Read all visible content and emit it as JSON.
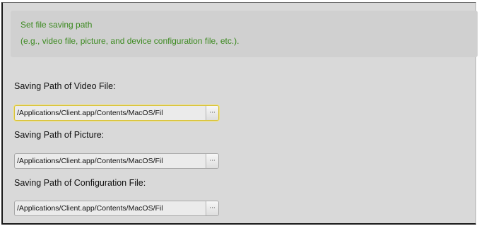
{
  "info": {
    "line1": "Set file saving path",
    "line2": "(e.g., video file, picture, and device configuration file, etc.)."
  },
  "fields": [
    {
      "label": "Saving Path of Video File:",
      "value": "/Applications/Client.app/Contents/MacOS/Fil",
      "button": "···",
      "focused": true
    },
    {
      "label": "Saving Path of Picture:",
      "value": "/Applications/Client.app/Contents/MacOS/Fil",
      "button": "···",
      "focused": false
    },
    {
      "label": "Saving Path of Configuration File:",
      "value": "/Applications/Client.app/Contents/MacOS/Fil",
      "button": "···",
      "focused": false
    }
  ],
  "colors": {
    "info_text": "#3c8a20",
    "focus_ring": "#d8c23a"
  }
}
